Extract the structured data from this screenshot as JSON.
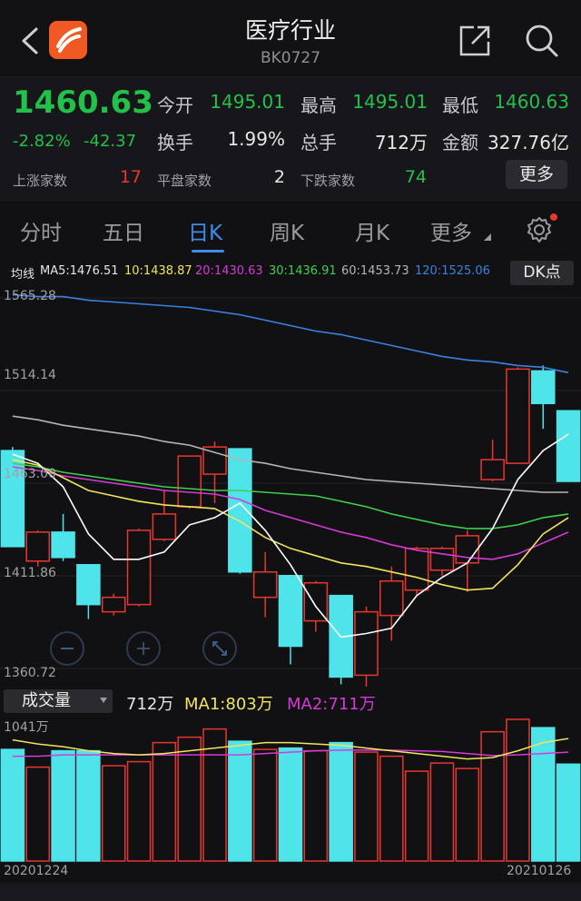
{
  "header": {
    "title": "医疗行业",
    "code": "BK0727"
  },
  "quote": {
    "price": "1460.63",
    "change_pct": "-2.82%",
    "change": "-42.37",
    "open_label": "今开",
    "open": "1495.01",
    "high_label": "最高",
    "high": "1495.01",
    "low_label": "最低",
    "low": "1460.63",
    "turnover_label": "换手",
    "turnover": "1.99%",
    "volume_label": "总手",
    "volume": "712万",
    "amount_label": "金额",
    "amount": "327.76亿",
    "up_label": "上涨家数",
    "up": "17",
    "flat_label": "平盘家数",
    "flat": "2",
    "down_label": "下跌家数",
    "down": "74",
    "more_label": "更多"
  },
  "tabs": [
    "分时",
    "五日",
    "日K",
    "周K",
    "月K",
    "更多"
  ],
  "ma": {
    "title": "均线",
    "ma5": "MA5:1476.51",
    "ma10": "10:1438.87",
    "ma20": "20:1430.63",
    "ma30": "30:1436.91",
    "ma60": "60:1453.73",
    "ma120": "120:1525.06",
    "dk_label": "DK点"
  },
  "price_axis": [
    "1565.28",
    "1514.14",
    "1463.00",
    "1411.86",
    "1360.72"
  ],
  "volume": {
    "selector": "成交量",
    "vol": "712万",
    "ma1": "MA1:803万",
    "ma2": "MA2:711万",
    "max_label": "1041万"
  },
  "dates": {
    "start": "20201224",
    "end": "20210126"
  },
  "colors": {
    "up": "#e8372f",
    "down": "#4fe3ea",
    "ma5": "#ffffff",
    "ma10": "#f2e45c",
    "ma20": "#d63ad6",
    "ma30": "#3ed04a",
    "ma60": "#b5b5b5",
    "ma120": "#3b82e0"
  },
  "chart_data": {
    "type": "candlestick",
    "price_range": [
      1360.72,
      1565.28
    ],
    "candles": [
      {
        "open": 1481,
        "close": 1428,
        "high": 1483,
        "low": 1428
      },
      {
        "open": 1420,
        "close": 1436,
        "high": 1437,
        "low": 1417
      },
      {
        "open": 1436,
        "close": 1422,
        "high": 1446,
        "low": 1420
      },
      {
        "open": 1418,
        "close": 1396,
        "high": 1418,
        "low": 1388
      },
      {
        "open": 1392,
        "close": 1400,
        "high": 1402,
        "low": 1390
      },
      {
        "open": 1396,
        "close": 1437,
        "high": 1438,
        "low": 1395
      },
      {
        "open": 1432,
        "close": 1446,
        "high": 1459,
        "low": 1431
      },
      {
        "open": 1450,
        "close": 1478,
        "high": 1478,
        "low": 1449
      },
      {
        "open": 1468,
        "close": 1483,
        "high": 1486,
        "low": 1452
      },
      {
        "open": 1482,
        "close": 1414,
        "high": 1482,
        "low": 1413
      },
      {
        "open": 1400,
        "close": 1414,
        "high": 1425,
        "low": 1389
      },
      {
        "open": 1412,
        "close": 1373,
        "high": 1412,
        "low": 1363
      },
      {
        "open": 1387,
        "close": 1408,
        "high": 1409,
        "low": 1381
      },
      {
        "open": 1401,
        "close": 1356,
        "high": 1401,
        "low": 1352
      },
      {
        "open": 1357,
        "close": 1392,
        "high": 1395,
        "low": 1342
      },
      {
        "open": 1390,
        "close": 1409,
        "high": 1417,
        "low": 1376
      },
      {
        "open": 1404,
        "close": 1427,
        "high": 1428,
        "low": 1401
      },
      {
        "open": 1415,
        "close": 1427,
        "high": 1428,
        "low": 1412
      },
      {
        "open": 1419,
        "close": 1434,
        "high": 1437,
        "low": 1403
      },
      {
        "open": 1465,
        "close": 1476,
        "high": 1487,
        "low": 1464
      },
      {
        "open": 1474,
        "close": 1526,
        "high": 1527,
        "low": 1474
      },
      {
        "open": 1525,
        "close": 1507,
        "high": 1528,
        "low": 1493
      },
      {
        "open": 1503,
        "close": 1464,
        "high": 1503,
        "low": 1464
      }
    ],
    "ma5": [
      1479,
      1474,
      1461,
      1435,
      1421,
      1421,
      1425,
      1440,
      1444,
      1452,
      1437,
      1418,
      1395,
      1378,
      1380,
      1383,
      1401,
      1411,
      1419,
      1438,
      1465,
      1481,
      1490
    ],
    "ma10": [
      1476,
      1473,
      1466,
      1459,
      1456,
      1453,
      1451,
      1450,
      1449,
      1442,
      1433,
      1427,
      1423,
      1419,
      1417,
      1414,
      1411,
      1407,
      1404,
      1405,
      1418,
      1435,
      1444
    ],
    "ma20": [
      1472,
      1470,
      1467,
      1465,
      1463,
      1461,
      1459,
      1458,
      1457,
      1454,
      1448,
      1444,
      1440,
      1436,
      1433,
      1429,
      1426,
      1424,
      1422,
      1421,
      1424,
      1430,
      1436
    ],
    "ma30": [
      1474,
      1472,
      1469,
      1467,
      1465,
      1463,
      1461,
      1460,
      1459,
      1459,
      1458,
      1457,
      1456,
      1453,
      1450,
      1446,
      1443,
      1440,
      1438,
      1438,
      1440,
      1444,
      1446
    ],
    "ma60": [
      1500,
      1498,
      1495,
      1493,
      1491,
      1489,
      1486,
      1484,
      1480,
      1476,
      1474,
      1471,
      1469,
      1467,
      1465,
      1464,
      1463,
      1462,
      1461,
      1460,
      1459,
      1458,
      1458
    ],
    "ma120": [
      1567,
      1566,
      1566,
      1564,
      1563,
      1562,
      1561,
      1560,
      1558,
      1556,
      1553,
      1550,
      1547,
      1545,
      1542,
      1539,
      1536,
      1533,
      1531,
      1530,
      1528,
      1527,
      1524
    ],
    "volumes": [
      820,
      690,
      810,
      810,
      700,
      730,
      870,
      910,
      970,
      880,
      820,
      830,
      810,
      870,
      800,
      770,
      660,
      720,
      680,
      950,
      1041,
      980,
      712
    ],
    "vol_ma1": [
      890,
      860,
      840,
      810,
      790,
      780,
      790,
      810,
      830,
      850,
      870,
      870,
      860,
      850,
      830,
      810,
      790,
      770,
      750,
      760,
      810,
      870,
      900
    ],
    "vol_ma2": [
      770,
      770,
      780,
      780,
      780,
      780,
      780,
      780,
      780,
      780,
      790,
      800,
      810,
      815,
      815,
      815,
      810,
      805,
      790,
      775,
      780,
      790,
      800
    ],
    "volume_range": [
      0,
      1041
    ]
  }
}
